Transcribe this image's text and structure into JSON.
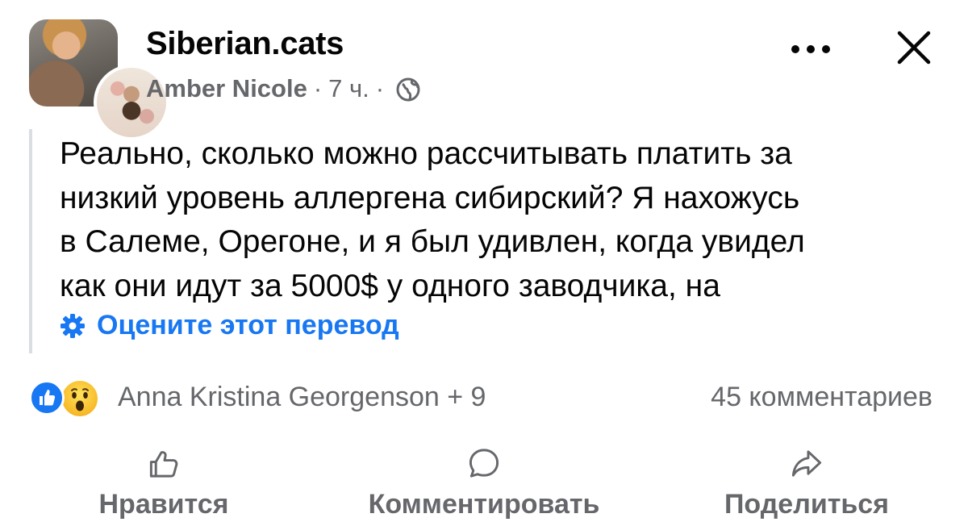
{
  "header": {
    "group_name": "Siberian.cats",
    "author": "Amber Nicole",
    "separator": "·",
    "time": "7 ч.",
    "privacy_icon": "globe-icon",
    "more_icon": "more-dots-icon",
    "close_icon": "close-icon"
  },
  "post": {
    "text_lines": [
      "Реально, сколько можно рассчитывать платить за",
      "низкий уровень аллергена сибирский? Я нахожусь",
      "в Салеме, Орегоне, и я был удивлен, когда увидел",
      "как они идут за 5000$ у одного заводчика, на"
    ],
    "rate_translation": "Оцените этот перевод"
  },
  "reactions": {
    "icons": [
      "like-reaction-icon",
      "wow-reaction-icon"
    ],
    "reactors": "Anna Kristina Georgenson + 9",
    "comments": "45 комментариев"
  },
  "actions": {
    "like": "Нравится",
    "comment": "Комментировать",
    "share": "Поделиться"
  },
  "colors": {
    "text": "#050505",
    "secondary": "#65676b",
    "accent": "#1877f2",
    "quote_bar": "#dadde1"
  }
}
